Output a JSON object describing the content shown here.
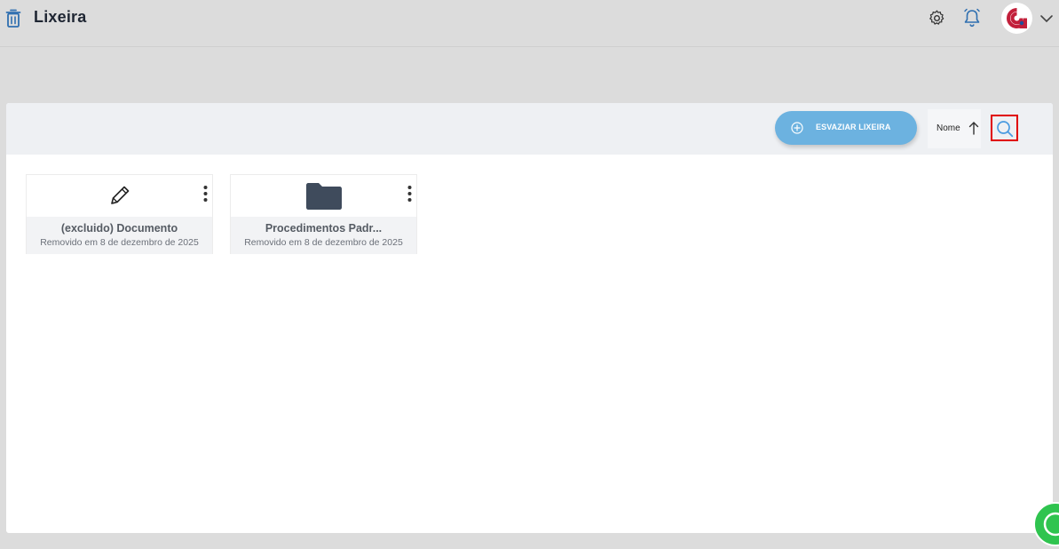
{
  "header": {
    "title": "Lixeira",
    "icons": [
      "trash-icon",
      "gear-icon",
      "bell-icon",
      "avatar",
      "chevron-down-icon"
    ]
  },
  "toolbar": {
    "empty_button_label": "ESVAZIAR LIXEIRA",
    "sort_label": "Nome",
    "sort_direction_icon": "arrow-up-icon",
    "search_icon": "search-icon"
  },
  "items": [
    {
      "name": "(excluido) Documento",
      "date": "Removido em 8 de dezembro de 2025",
      "icon": "pencil-icon"
    },
    {
      "name": "Procedimentos Padr...",
      "date": "Removido em 8 de dezembro de 2025",
      "icon": "folder-icon"
    }
  ],
  "colors": {
    "accent": "#6cb2e0",
    "folder": "#3f4b5c",
    "highlight": "#e00000",
    "whatsapp": "#2fc44f"
  }
}
